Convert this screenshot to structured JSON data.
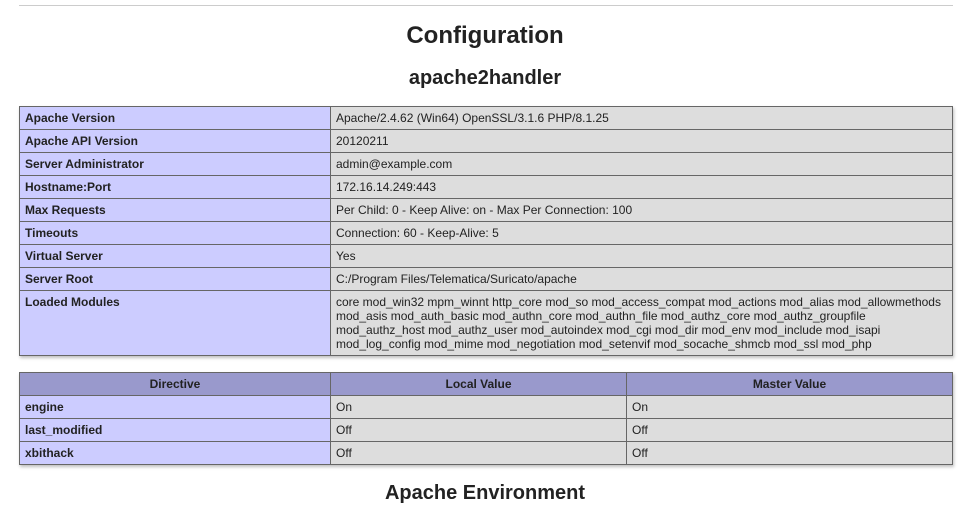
{
  "page": {
    "title": "Configuration",
    "section_title": "apache2handler",
    "next_section_title": "Apache Environment"
  },
  "info_rows": [
    {
      "label": "Apache Version",
      "value": "Apache/2.4.62 (Win64) OpenSSL/3.1.6 PHP/8.1.25"
    },
    {
      "label": "Apache API Version",
      "value": "20120211"
    },
    {
      "label": "Server Administrator",
      "value": "admin@example.com"
    },
    {
      "label": "Hostname:Port",
      "value": "172.16.14.249:443"
    },
    {
      "label": "Max Requests",
      "value": "Per Child: 0 - Keep Alive: on - Max Per Connection: 100"
    },
    {
      "label": "Timeouts",
      "value": "Connection: 60 - Keep-Alive: 5"
    },
    {
      "label": "Virtual Server",
      "value": "Yes"
    },
    {
      "label": "Server Root",
      "value": "C:/Program Files/Telematica/Suricato/apache"
    },
    {
      "label": "Loaded Modules",
      "value": "core mod_win32 mpm_winnt http_core mod_so mod_access_compat mod_actions mod_alias mod_allowmethods mod_asis mod_auth_basic mod_authn_core mod_authn_file mod_authz_core mod_authz_groupfile mod_authz_host mod_authz_user mod_autoindex mod_cgi mod_dir mod_env mod_include mod_isapi mod_log_config mod_mime mod_negotiation mod_setenvif mod_socache_shmcb mod_ssl mod_php"
    }
  ],
  "directives": {
    "headers": [
      "Directive",
      "Local Value",
      "Master Value"
    ],
    "rows": [
      {
        "name": "engine",
        "local": "On",
        "master": "On"
      },
      {
        "name": "last_modified",
        "local": "Off",
        "master": "Off"
      },
      {
        "name": "xbithack",
        "local": "Off",
        "master": "Off"
      }
    ]
  }
}
